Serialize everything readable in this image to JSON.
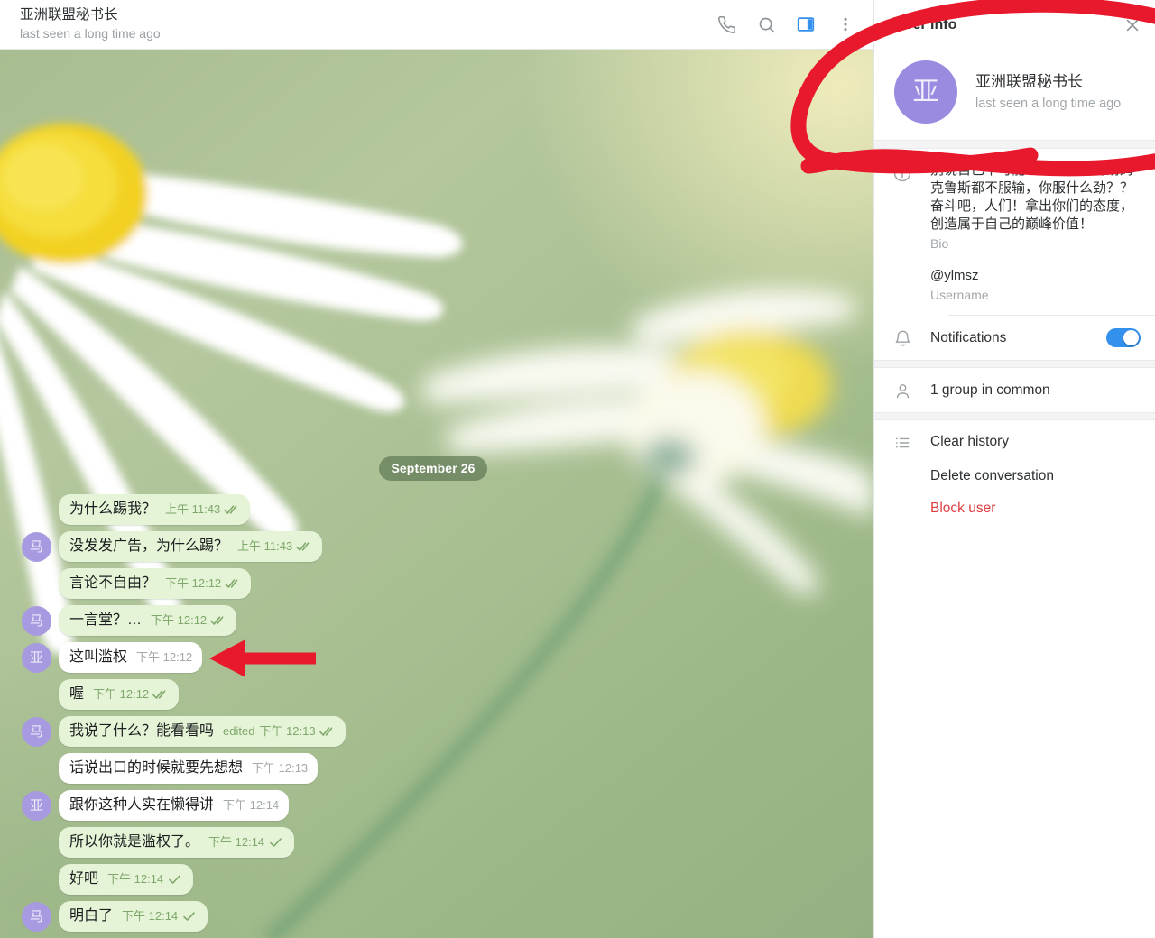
{
  "chat_header": {
    "title": "亚洲联盟秘书长",
    "subtitle": "last seen a long time ago",
    "icons": {
      "call": "phone-icon",
      "search": "search-icon",
      "panel": "right-panel-toggle-icon",
      "more": "more-vertical-icon"
    }
  },
  "conversation": {
    "date_divider": "September 26",
    "messages": [
      {
        "avatar": "",
        "text": "为什么踢我？",
        "time": "上午 11:43",
        "status": "read",
        "edited": "",
        "side": "out"
      },
      {
        "avatar": "马",
        "text": "没发发广告，为什么踢？",
        "time": "上午 11:43",
        "status": "read",
        "edited": "",
        "side": "out"
      },
      {
        "avatar": "",
        "text": "言论不自由？",
        "time": "下午 12:12",
        "status": "read",
        "edited": "",
        "side": "out"
      },
      {
        "avatar": "马",
        "text": "一言堂？…",
        "time": "下午 12:12",
        "status": "read",
        "edited": "",
        "side": "out"
      },
      {
        "avatar": "亚",
        "text": "这叫滥权",
        "time": "下午 12:12",
        "status": "none",
        "edited": "",
        "side": "in"
      },
      {
        "avatar": "",
        "text": "喔",
        "time": "下午 12:12",
        "status": "read",
        "edited": "",
        "side": "out"
      },
      {
        "avatar": "马",
        "text": "我说了什么？能看看吗",
        "time": "下午 12:13",
        "status": "read",
        "edited": "edited",
        "side": "out"
      },
      {
        "avatar": "",
        "text": "话说出口的时候就要先想想",
        "time": "下午 12:13",
        "status": "none",
        "edited": "",
        "side": "in"
      },
      {
        "avatar": "亚",
        "text": "跟你这种人实在懒得讲",
        "time": "下午 12:14",
        "status": "none",
        "edited": "",
        "side": "in"
      },
      {
        "avatar": "",
        "text": "所以你就是滥权了。",
        "time": "下午 12:14",
        "status": "sent",
        "edited": "",
        "side": "out"
      },
      {
        "avatar": "",
        "text": "好吧",
        "time": "下午 12:14",
        "status": "sent",
        "edited": "",
        "side": "out"
      },
      {
        "avatar": "马",
        "text": "明白了",
        "time": "下午 12:14",
        "status": "sent",
        "edited": "",
        "side": "out"
      }
    ]
  },
  "user_info_panel": {
    "title": "User Info",
    "close_icon": "close-icon",
    "profile": {
      "avatar_initials": "亚",
      "name": "亚洲联盟秘书长",
      "status": "last seen a long time ago"
    },
    "info_icon": "info-icon",
    "bio": {
      "value": "别说自己不可能！年过半百的汤姆克鲁斯都不服输，你服什么劲？？奋斗吧，人们！拿出你们的态度，创造属于自己的巅峰价值！",
      "label": "Bio"
    },
    "username": {
      "value": "@ylmsz",
      "label": "Username"
    },
    "notifications": {
      "icon": "bell-icon",
      "label": "Notifications",
      "enabled": "on"
    },
    "groups_in_common": {
      "icon": "person-icon",
      "label": "1 group in common"
    },
    "actions": {
      "icon": "list-icon",
      "items": [
        {
          "label": "Clear history",
          "danger": "no"
        },
        {
          "label": "Delete conversation",
          "danger": "no"
        },
        {
          "label": "Block user",
          "danger": "yes"
        }
      ]
    }
  },
  "annotations": {
    "ellipse": "red-ellipse-highlight",
    "arrow": "red-arrow-pointer"
  },
  "colors": {
    "accent_blue": "#3390ec",
    "annotation_red": "#e8192c",
    "avatar_purple": "#9a8ae0",
    "out_bubble": "#e5f3d6",
    "in_bubble": "#ffffff",
    "danger": "#df3f40"
  }
}
